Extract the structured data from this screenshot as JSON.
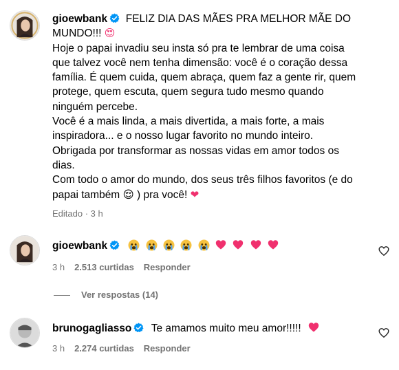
{
  "caption": {
    "username": "gioewbank",
    "lines": [
      "FELIZ DIA DAS MÃES PRA MELHOR MÃE DO",
      "MUNDO!!!",
      "Hoje o papai invadiu seu insta só pra te lembrar de uma coisa",
      "que talvez você nem tenha dimensão: você é o coração dessa",
      "família. É quem cuida, quem abraça, quem faz a gente rir, quem",
      "protege, quem escuta, quem segura tudo mesmo quando",
      "ninguém percebe.",
      "Você é a mais linda, a mais divertida, a mais forte, a mais",
      "inspiradora... e o nosso lugar favorito no mundo inteiro.",
      "Obrigada por transformar as nossas vidas em amor todos os",
      "dias.",
      "Com todo o amor do mundo, dos seus três filhos favoritos (e do",
      "papai também",
      ") pra você!"
    ],
    "edited_label": "Editado",
    "time": "3 h"
  },
  "comments": [
    {
      "username": "gioewbank",
      "time": "3 h",
      "likes": "2.513 curtidas",
      "reply_label": "Responder"
    },
    {
      "username": "brunogagliasso",
      "text": "Te amamos muito meu amor!!!!!",
      "time": "3 h",
      "likes": "2.274 curtidas",
      "reply_label": "Responder"
    }
  ],
  "view_replies": "Ver respostas (14)",
  "colors": {
    "verified": "#0095f6",
    "heart": "#f0306e",
    "meta": "#737373"
  }
}
